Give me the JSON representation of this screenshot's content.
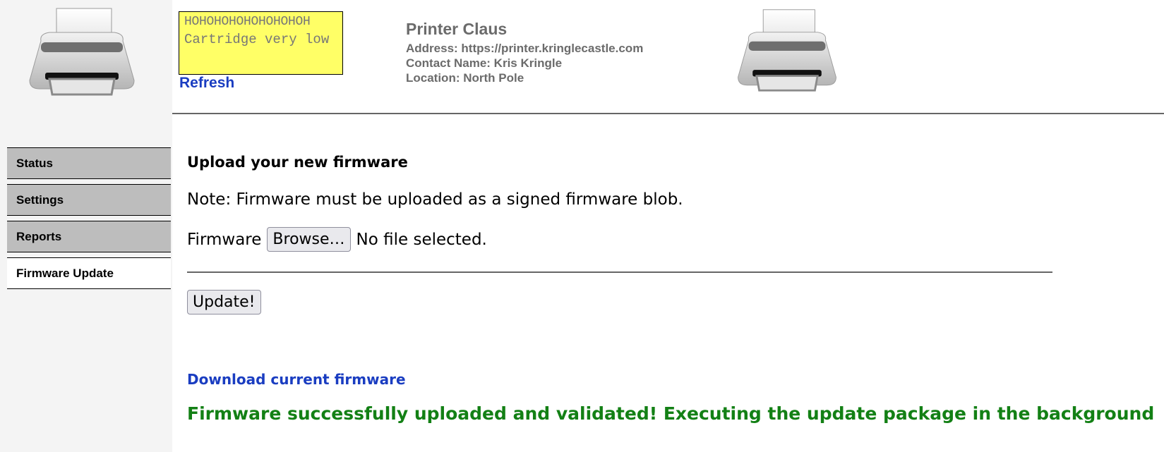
{
  "status": {
    "line1": "HOHOHOHOHOHOHOHOH",
    "line2": "Cartridge very low",
    "refresh_label": "Refresh"
  },
  "printer_info": {
    "name": "Printer Claus",
    "address": "Address: https://printer.kringlecastle.com",
    "contact": "Contact Name: Kris Kringle",
    "location": "Location: North Pole"
  },
  "nav": {
    "items": [
      {
        "label": "Status"
      },
      {
        "label": "Settings"
      },
      {
        "label": "Reports"
      },
      {
        "label": "Firmware Update",
        "active": true
      }
    ]
  },
  "main": {
    "heading": "Upload your new firmware",
    "note": "Note: Firmware must be uploaded as a signed firmware blob.",
    "firmware_label": "Firmware",
    "browse_label": "Browse…",
    "file_status": "No file selected.",
    "update_label": "Update!",
    "download_label": "Download current firmware",
    "success_message": "Firmware successfully uploaded and validated! Executing the update package in the background"
  },
  "colors": {
    "status_bg": "#ffff66",
    "link": "#1a3dc1",
    "success": "#138015",
    "sidebar_bg": "#f4f4f4",
    "nav_bg": "#bdbdbd"
  },
  "icons": {
    "logo": "printer-icon"
  }
}
